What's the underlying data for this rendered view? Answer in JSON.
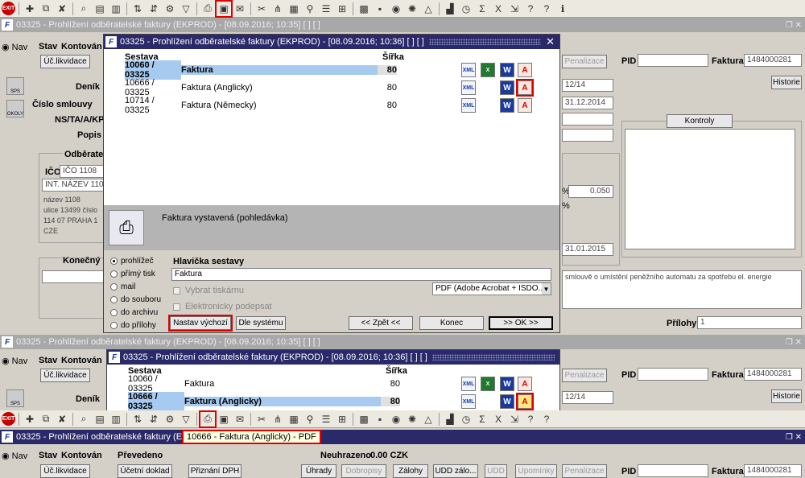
{
  "window_title_bg": "03325 - Prohlížení odběratelské faktury (EKPROD) - [08.09.2016; 10:35]  [ ]  [ ]",
  "window_title_bottom": "03325 - Prohlížení odběratelské faktury (EK",
  "window_title_mid": "03325 - Prohlížení odběratelské faktury (EKPROD) - [08.09.2016; 10:35]  [ ]  [ ]",
  "nav_label": "Nav",
  "toolbar_exit": "EXIT",
  "form": {
    "stav": "Stav",
    "kontovan": "Kontován",
    "prevedeno": "Převedeno",
    "uc_likvidace": "Úč.likvidace",
    "ucetni_doklad": "Účetní doklad",
    "priznani_dph": "Přiznání DPH",
    "neuhrazeno": "Neuhrazeno",
    "neuhrazeno_val": "0.00 CZK",
    "uhrady": "Úhrady",
    "dobropisy": "Dobropisy",
    "zalohy": "Zálohy",
    "udd_zalo": "UDD zálo...",
    "udd": "UDD",
    "upominky": "Upomínky",
    "penalizace": "Penalizace",
    "pid": "PID",
    "faktura": "Faktura",
    "faktura_val": "1484000281",
    "denik": "Deník",
    "cislo_smlouvy": "Číslo smlouvy",
    "ns_ta": "NS/TA/A/KP",
    "popis": "Popis",
    "odberatel": "Odběratel",
    "ico": "IČO",
    "ico_val": "IČO 1108",
    "int_nazev": "INT. NÁZEV 1108",
    "addr_nazev": "název 1108",
    "addr_ulice": "ulice 13499 číslo",
    "addr_mesto": "114 07 PRAHA 1",
    "addr_stat": "CZE",
    "konecny": "Konečný p",
    "historie": "Historie",
    "kontroly": "Kontroly",
    "val_1214": "12/14",
    "val_date1": "31.12.2014",
    "val_pct": "%",
    "val_0050": "0.050",
    "val_date2": "31.01.2015",
    "smlouva_text": "smlouvě o umístění peněžního automatu za spotřebu el. energie",
    "prilohy": "Přílohy",
    "prilohy_val": "1",
    "sps": "SPS",
    "okoly": "OKOLY"
  },
  "dialog1": {
    "title": "03325 - Prohlížení odběratelské faktury (EKPROD) - [08.09.2016; 10:36]  [ ]  [ ]",
    "col_sestava": "Sestava",
    "col_sirka": "Šířka",
    "rows": [
      {
        "code": "10060 / 03325",
        "name": "Faktura",
        "width": "80"
      },
      {
        "code": "10666 / 03325",
        "name": "Faktura (Anglicky)",
        "width": "80"
      },
      {
        "code": "10714 / 03325",
        "name": "Faktura (Německy)",
        "width": "80"
      }
    ],
    "desc": "Faktura vystavená (pohledávka)",
    "out_options": [
      "prohlížeč",
      "přímý tisk",
      "mail",
      "do souboru",
      "do archivu",
      "do přílohy"
    ],
    "hlavicka_label": "Hlavička sestavy",
    "hlavicka_val": "Faktura",
    "vybrat_tiskarnu": "Vybrat tiskárnu",
    "el_podpis": "Elektronicky podepsat",
    "printer_val": "PDF (Adobe Acrobat + ISDO...",
    "btn_nastav": "Nastav výchozí",
    "btn_dle": "Dle systému",
    "btn_zpet": "<< Zpět <<",
    "btn_konec": "Konec",
    "btn_ok": ">> OK >>"
  },
  "dialog2": {
    "title": "03325 - Prohlížení odběratelské faktury (EKPROD) - [08.09.2016; 10:36]  [ ]  [ ]",
    "col_sestava": "Sestava",
    "col_sirka": "Šířka",
    "rows": [
      {
        "code": "10060 / 03325",
        "name": "Faktura",
        "width": "80"
      },
      {
        "code": "10666 / 03325",
        "name": "Faktura (Anglicky)",
        "width": "80"
      }
    ]
  },
  "tooltip": "10666 - Faktura (Anglicky) - PDF",
  "icons": {
    "xml": "XML",
    "xls": "X",
    "doc": "W",
    "pdf": "A"
  }
}
